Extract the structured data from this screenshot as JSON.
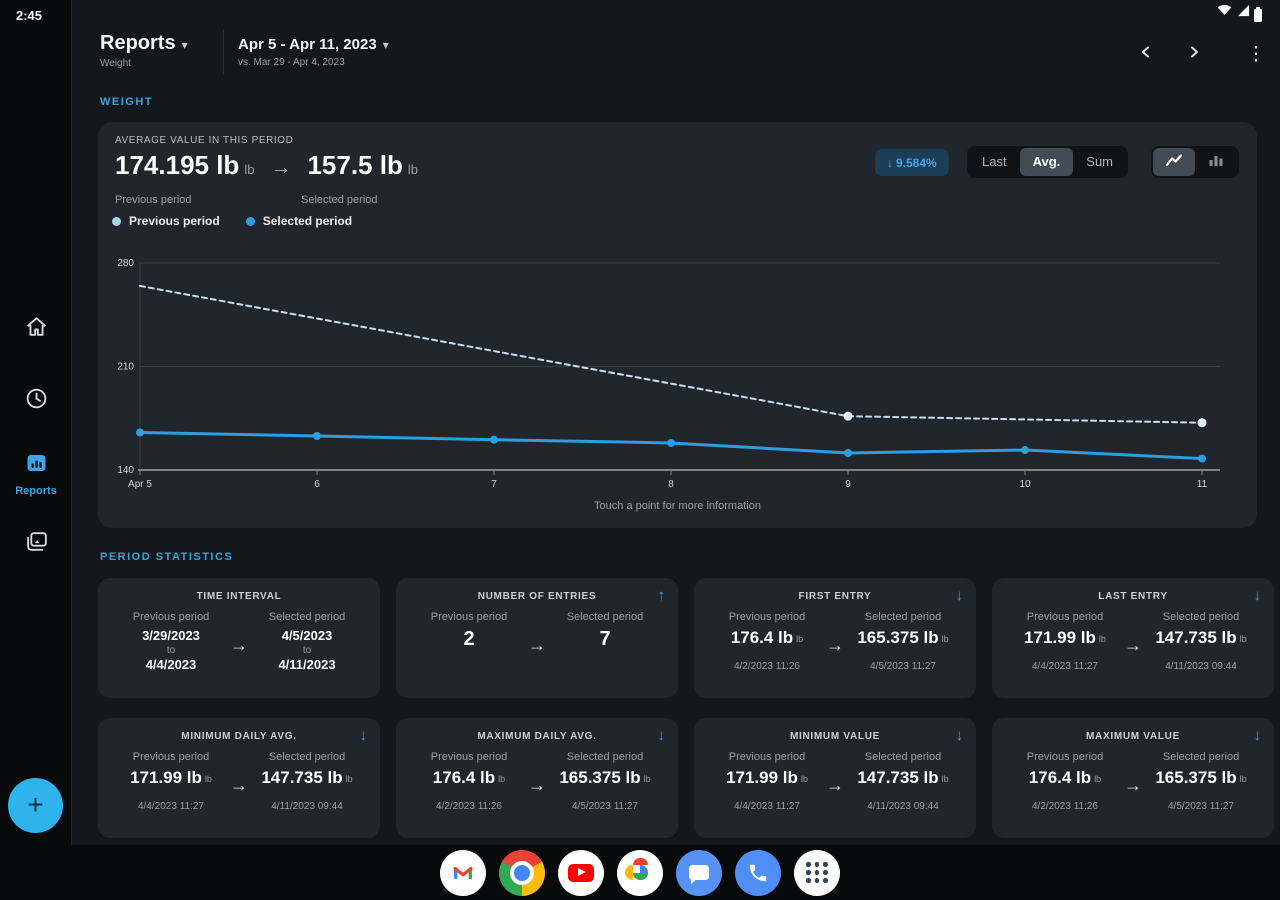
{
  "status_bar": {
    "time": "2:45",
    "icons": [
      "wifi-icon",
      "signal-icon",
      "battery-icon"
    ]
  },
  "header": {
    "title": "Reports",
    "subtitle": "Weight",
    "date_range": "Apr 5 - Apr 11, 2023",
    "date_compare": "vs. Mar 29 - Apr 4, 2023",
    "nav": [
      "chevron-left",
      "chevron-right",
      "kebab-menu"
    ]
  },
  "sidebar": {
    "items": [
      {
        "name": "home",
        "icon": "home-icon",
        "active": false
      },
      {
        "name": "history",
        "icon": "clock-icon",
        "active": false
      },
      {
        "name": "reports",
        "icon": "bar-chart-icon",
        "label": "Reports",
        "active": true
      },
      {
        "name": "library",
        "icon": "collections-icon",
        "active": false
      }
    ]
  },
  "sections": {
    "weight": "WEIGHT",
    "period_stats": "PERIOD STATISTICS"
  },
  "summary": {
    "title": "AVERAGE VALUE IN THIS PERIOD",
    "prev": {
      "value": "174.195 lb",
      "unit": "lb",
      "label": "Previous period"
    },
    "sel": {
      "value": "157.5 lb",
      "unit": "lb",
      "label": "Selected period"
    },
    "arrow": "→",
    "change": {
      "direction": "down",
      "icon": "arrow-down-icon",
      "text": "9.584%"
    },
    "agg": {
      "options": [
        "Last",
        "Avg.",
        "Sum"
      ],
      "selected": "Avg."
    },
    "chart_type": {
      "options": [
        "line",
        "bar"
      ],
      "selected": "line"
    }
  },
  "legend": {
    "items": [
      {
        "label": "Previous period",
        "color": "#a9d3e8"
      },
      {
        "label": "Selected period",
        "color": "#2d9fe0"
      }
    ]
  },
  "chart_data": {
    "type": "line",
    "x": [
      "Apr 5",
      "6",
      "7",
      "8",
      "9",
      "10",
      "11"
    ],
    "ylim": [
      140,
      280
    ],
    "yticks": [
      280,
      210,
      140
    ],
    "grid": "horizontal",
    "legend_position": "top-left",
    "caption": "Touch a point for more information",
    "series": [
      {
        "name": "Previous period",
        "style": "dashed",
        "color": "#c6dfee",
        "marker_color": "#e3f1fa",
        "points": [
          {
            "day": 0,
            "value": 264.5,
            "marker": false
          },
          {
            "day": 4,
            "value": 176.4,
            "marker": true
          },
          {
            "day": 6,
            "value": 171.99,
            "marker": true
          }
        ]
      },
      {
        "name": "Selected period",
        "style": "solid",
        "color": "#2d9fe0",
        "marker_color": "#2d9fe0",
        "points": [
          {
            "day": 0,
            "value": 165.375,
            "marker": true
          },
          {
            "day": 1,
            "value": 163.0,
            "marker": true
          },
          {
            "day": 2,
            "value": 160.5,
            "marker": true
          },
          {
            "day": 3,
            "value": 158.3,
            "marker": true
          },
          {
            "day": 4,
            "value": 151.5,
            "marker": true
          },
          {
            "day": 5,
            "value": 153.5,
            "marker": true
          },
          {
            "day": 6,
            "value": 147.735,
            "marker": true
          }
        ]
      }
    ]
  },
  "stats": {
    "cards": [
      {
        "title": "TIME INTERVAL",
        "trend": null,
        "prev": {
          "label": "Previous period",
          "rows": [
            "3/29/2023",
            "to",
            "4/4/2023"
          ]
        },
        "sel": {
          "label": "Selected period",
          "rows": [
            "4/5/2023",
            "to",
            "4/11/2023"
          ]
        }
      },
      {
        "title": "NUMBER OF ENTRIES",
        "trend": "up",
        "prev": {
          "label": "Previous period",
          "value": "2",
          "unit": "",
          "sub": ""
        },
        "sel": {
          "label": "Selected period",
          "value": "7",
          "unit": "",
          "sub": ""
        }
      },
      {
        "title": "FIRST ENTRY",
        "trend": "down",
        "prev": {
          "label": "Previous period",
          "value": "176.4 lb",
          "unit": "lb",
          "sub": "4/2/2023 11:26"
        },
        "sel": {
          "label": "Selected period",
          "value": "165.375 lb",
          "unit": "lb",
          "sub": "4/5/2023 11:27"
        }
      },
      {
        "title": "LAST ENTRY",
        "trend": "down",
        "prev": {
          "label": "Previous period",
          "value": "171.99 lb",
          "unit": "lb",
          "sub": "4/4/2023 11:27"
        },
        "sel": {
          "label": "Selected period",
          "value": "147.735 lb",
          "unit": "lb",
          "sub": "4/11/2023 09:44"
        }
      },
      {
        "title": "MINIMUM DAILY AVG.",
        "trend": "down",
        "prev": {
          "label": "Previous period",
          "value": "171.99 lb",
          "unit": "lb",
          "sub": "4/4/2023 11:27"
        },
        "sel": {
          "label": "Selected period",
          "value": "147.735 lb",
          "unit": "lb",
          "sub": "4/11/2023 09:44"
        }
      },
      {
        "title": "MAXIMUM DAILY AVG.",
        "trend": "down",
        "prev": {
          "label": "Previous period",
          "value": "176.4 lb",
          "unit": "lb",
          "sub": "4/2/2023 11:26"
        },
        "sel": {
          "label": "Selected period",
          "value": "165.375 lb",
          "unit": "lb",
          "sub": "4/5/2023 11:27"
        }
      },
      {
        "title": "MINIMUM VALUE",
        "trend": "down",
        "prev": {
          "label": "Previous period",
          "value": "171.99 lb",
          "unit": "lb",
          "sub": "4/4/2023 11:27"
        },
        "sel": {
          "label": "Selected period",
          "value": "147.735 lb",
          "unit": "lb",
          "sub": "4/11/2023 09:44"
        }
      },
      {
        "title": "MAXIMUM VALUE",
        "trend": "down",
        "prev": {
          "label": "Previous period",
          "value": "176.4 lb",
          "unit": "lb",
          "sub": "4/2/2023 11:26"
        },
        "sel": {
          "label": "Selected period",
          "value": "165.375 lb",
          "unit": "lb",
          "sub": "4/5/2023 11:27"
        }
      }
    ]
  },
  "fab": {
    "icon": "plus-icon",
    "symbol": "+"
  },
  "dock": [
    {
      "name": "gmail"
    },
    {
      "name": "chrome"
    },
    {
      "name": "youtube"
    },
    {
      "name": "photos"
    },
    {
      "name": "messages"
    },
    {
      "name": "phone"
    },
    {
      "name": "app-drawer"
    }
  ],
  "colors": {
    "accent_blue": "#3ea6e8",
    "section_label_blue": "#38a1dc",
    "selected_line": "#2d9fe0",
    "previous_line": "#c6dfee",
    "fab": "#2fb3ec",
    "badge_bg": "#1d3d57",
    "card_bg": "#21262c",
    "surface_bg": "#14181c",
    "shell_bg": "#07090b"
  }
}
